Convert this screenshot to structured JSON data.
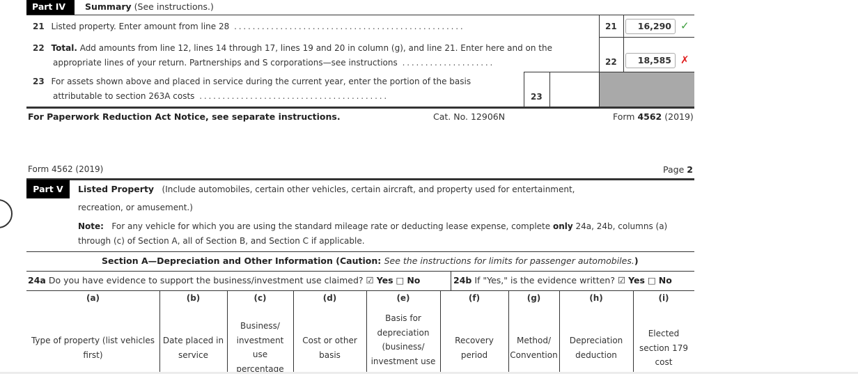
{
  "part4": {
    "tag": "Part IV",
    "title_bold": "Summary",
    "title_rest": " (See instructions.)",
    "lines": [
      {
        "num": "21",
        "text": "Listed property. Enter amount from line 28",
        "leaders": ". . . . . . . . . . . . . . . . . . . . . . . . . . . . . . . . . . . . . . . . . . . . . . . . . .",
        "box_label": "21",
        "value": "16,290",
        "status": "correct",
        "status_icon": "✓"
      },
      {
        "num": "22",
        "text_bold": "Total.",
        "text_line1": " Add amounts from line 12, lines 14 through 17, lines 19 and 20 in column (g), and line 21. Enter here and on the",
        "text_line2": "appropriate lines of your return. Partnerships and S corporations—see instructions",
        "leaders": ". . . . . . . . . . . . . . . . . . . .",
        "box_label": "22",
        "value": "18,585",
        "status": "incorrect",
        "status_icon": "✗"
      },
      {
        "num": "23",
        "text_line1": "For assets shown above and placed in service during the current year, enter the portion of the basis",
        "text_line2": "attributable to section 263A costs",
        "leaders": ". . . . . . . . . . . . . . . . . . . . . . . . . . . . . . . . . . . . . . . . .",
        "box_label": "23",
        "value": ""
      }
    ]
  },
  "footer": {
    "paperwork": "For Paperwork Reduction Act Notice, see separate instructions.",
    "cat_no": "Cat. No. 12906N",
    "form_prefix": "Form ",
    "form_num": "4562",
    "form_year": " (2019)"
  },
  "page2": {
    "form_label": "Form 4562 (2019)",
    "page_prefix": "Page ",
    "page_num": "2"
  },
  "part5": {
    "tag": "Part V",
    "title_bold": "Listed Property",
    "title_rest": "   (Include automobiles, certain other vehicles, certain aircraft, and property used for entertainment,",
    "title_line2": "recreation, or amusement.)",
    "note_label": "Note:",
    "note_text1": "   For any vehicle for which you are using the standard mileage rate or deducting lease expense, complete ",
    "note_only": "only",
    "note_text2": " 24a, 24b, columns (a)",
    "note_line2": "through (c) of Section A, all of Section B, and Section C if applicable.",
    "section_a_bold": "Section A—Depreciation and Other Information (Caution: ",
    "section_a_italic": "See the instructions for limits for passenger automobiles.",
    "section_a_close": ")",
    "q24a": {
      "label": "24a",
      "text": " Do you have evidence to support the business/investment use claimed? ",
      "yes_checked": true,
      "yes_label": "Yes",
      "no_checked": false,
      "no_label": "No"
    },
    "q24b": {
      "label": "24b",
      "text": " If \"Yes,\" is the evidence written? ",
      "yes_checked": true,
      "yes_label": "Yes",
      "no_checked": false,
      "no_label": "No"
    },
    "checkbox_checked_glyph": "☑",
    "checkbox_unchecked_glyph": "□",
    "columns": [
      {
        "letter": "(a)",
        "desc": [
          "Type of property (list vehicles",
          "first)"
        ]
      },
      {
        "letter": "(b)",
        "desc": [
          "Date placed in",
          "service"
        ]
      },
      {
        "letter": "(c)",
        "desc": [
          "Business/",
          "investment",
          "use",
          "percentage"
        ]
      },
      {
        "letter": "(d)",
        "desc": [
          "Cost or other",
          "basis"
        ]
      },
      {
        "letter": "(e)",
        "desc": [
          "Basis for",
          "depreciation",
          "(business/",
          "investment use"
        ]
      },
      {
        "letter": "(f)",
        "desc": [
          "Recovery",
          "period"
        ]
      },
      {
        "letter": "(g)",
        "desc": [
          "Method/",
          "Convention"
        ]
      },
      {
        "letter": "(h)",
        "desc": [
          "Depreciation",
          "deduction"
        ]
      },
      {
        "letter": "(i)",
        "desc": [
          "Elected",
          "section 179",
          "cost"
        ]
      }
    ]
  }
}
